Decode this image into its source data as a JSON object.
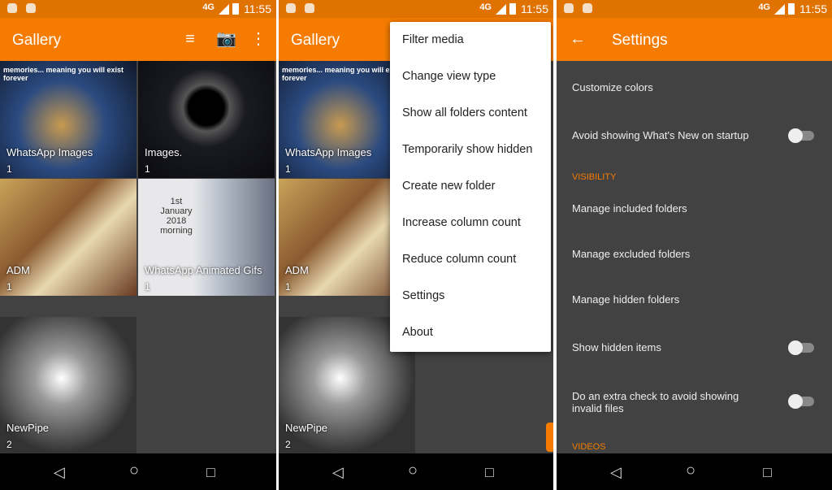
{
  "status": {
    "network": "4G",
    "time": "11:55"
  },
  "gallery": {
    "title": "Gallery",
    "icons": [
      "sort-icon",
      "camera-icon",
      "more-vert-icon"
    ],
    "top_caption": "memories... meaning you will exist forever",
    "folders": [
      {
        "name": "WhatsApp Images",
        "count": "1"
      },
      {
        "name": "Images.",
        "count": "1"
      },
      {
        "name": "ADM",
        "count": "1"
      },
      {
        "name": "WhatsApp Animated Gifs",
        "count": "1"
      },
      {
        "name": "NewPipe",
        "count": "2"
      }
    ],
    "thumb_text": "1st January 2018 morning"
  },
  "menu": {
    "items": [
      "Filter media",
      "Change view type",
      "Show all folders content",
      "Temporarily show hidden",
      "Create new folder",
      "Increase column count",
      "Reduce column count",
      "Settings",
      "About"
    ]
  },
  "settings": {
    "title": "Settings",
    "rows": [
      {
        "label": "Customize colors"
      },
      {
        "label": "Avoid showing What's New on startup",
        "toggle": false
      },
      {
        "label": "Manage included folders"
      },
      {
        "label": "Manage excluded folders"
      },
      {
        "label": "Manage hidden folders"
      },
      {
        "label": "Show hidden items",
        "toggle": false
      },
      {
        "label": "Do an extra check to avoid showing invalid files",
        "toggle": false
      }
    ],
    "sections": [
      "VISIBILITY",
      "VIDEOS"
    ]
  },
  "colors": {
    "accent": "#f57c00",
    "status": "#e07200",
    "background": "#424242"
  }
}
